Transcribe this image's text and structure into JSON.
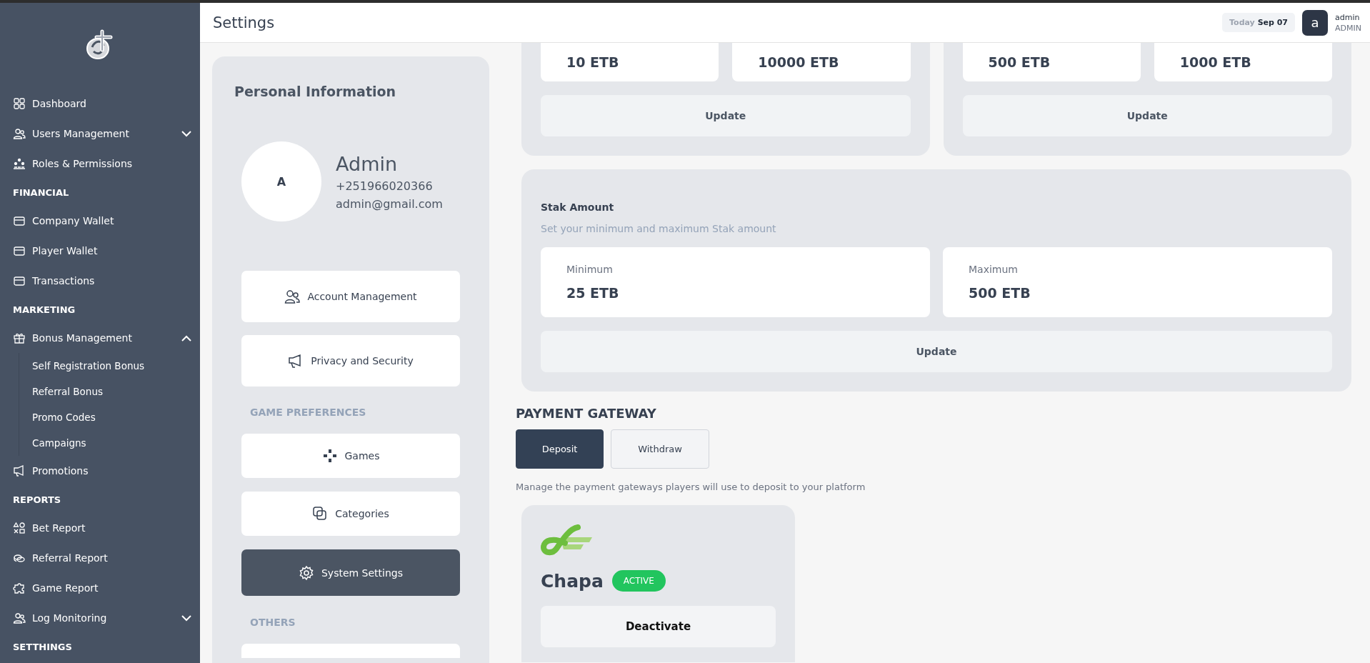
{
  "sidebar": {
    "items": [
      {
        "kind": "link",
        "label": "Dashboard"
      },
      {
        "kind": "group",
        "label": "Users Management",
        "expanded": false
      },
      {
        "kind": "link",
        "label": "Roles & Permissions"
      },
      {
        "kind": "section",
        "label": "FINANCIAL"
      },
      {
        "kind": "link",
        "label": "Company Wallet"
      },
      {
        "kind": "link",
        "label": "Player Wallet"
      },
      {
        "kind": "link",
        "label": "Transactions"
      },
      {
        "kind": "section",
        "label": "MARKETING"
      },
      {
        "kind": "group",
        "label": "Bonus Management",
        "expanded": true,
        "children": [
          {
            "label": "Self Registration Bonus"
          },
          {
            "label": "Referral Bonus"
          },
          {
            "label": "Promo Codes"
          },
          {
            "label": "Campaigns"
          }
        ]
      },
      {
        "kind": "link",
        "label": "Promotions"
      },
      {
        "kind": "section",
        "label": "REPORTS"
      },
      {
        "kind": "link",
        "label": "Bet Report"
      },
      {
        "kind": "link",
        "label": "Referral Report"
      },
      {
        "kind": "link",
        "label": "Game Report"
      },
      {
        "kind": "group",
        "label": "Log Monitoring",
        "expanded": false
      },
      {
        "kind": "section",
        "label": "SETTHINGS"
      }
    ]
  },
  "header": {
    "title": "Settings",
    "date_label": "Today",
    "date": "Sep 07",
    "user": {
      "avatar_letter": "a",
      "name": "admin",
      "role": "ADMIN"
    }
  },
  "profile": {
    "heading": "Personal Information",
    "avatar_letter": "A",
    "name": "Admin",
    "phone": "+251966020366",
    "email": "admin@gmail.com"
  },
  "menu": [
    {
      "kind": "button",
      "label": "Account Management",
      "selected": false
    },
    {
      "kind": "button",
      "label": "Privacy and Security",
      "selected": false
    },
    {
      "kind": "section",
      "label": "GAME PREFERENCES"
    },
    {
      "kind": "button",
      "label": "Games",
      "selected": false
    },
    {
      "kind": "button",
      "label": "Categories",
      "selected": false
    },
    {
      "kind": "button",
      "label": "System Settings",
      "selected": true
    },
    {
      "kind": "section",
      "label": "OTHERS"
    },
    {
      "kind": "partial"
    }
  ],
  "limit_cards": [
    {
      "values": [
        "10 ETB",
        "10000 ETB"
      ],
      "button": "Update"
    },
    {
      "values": [
        "500 ETB",
        "1000 ETB"
      ],
      "button": "Update"
    }
  ],
  "stake": {
    "title": "Stak Amount",
    "description": "Set your minimum and maximum Stak amount",
    "fields": [
      {
        "label": "Minimum",
        "value": "25 ETB"
      },
      {
        "label": "Maximum",
        "value": "500 ETB"
      }
    ],
    "button": "Update"
  },
  "payment": {
    "heading": "PAYMENT GATEWAY",
    "tabs": [
      {
        "label": "Deposit",
        "selected": true
      },
      {
        "label": "Withdraw",
        "selected": false
      }
    ],
    "description": "Manage the payment gateways players will use to deposit to your platform",
    "gateways": [
      {
        "name": "Chapa",
        "status": "ACTIVE",
        "active": true,
        "button": "Deactivate"
      }
    ]
  }
}
